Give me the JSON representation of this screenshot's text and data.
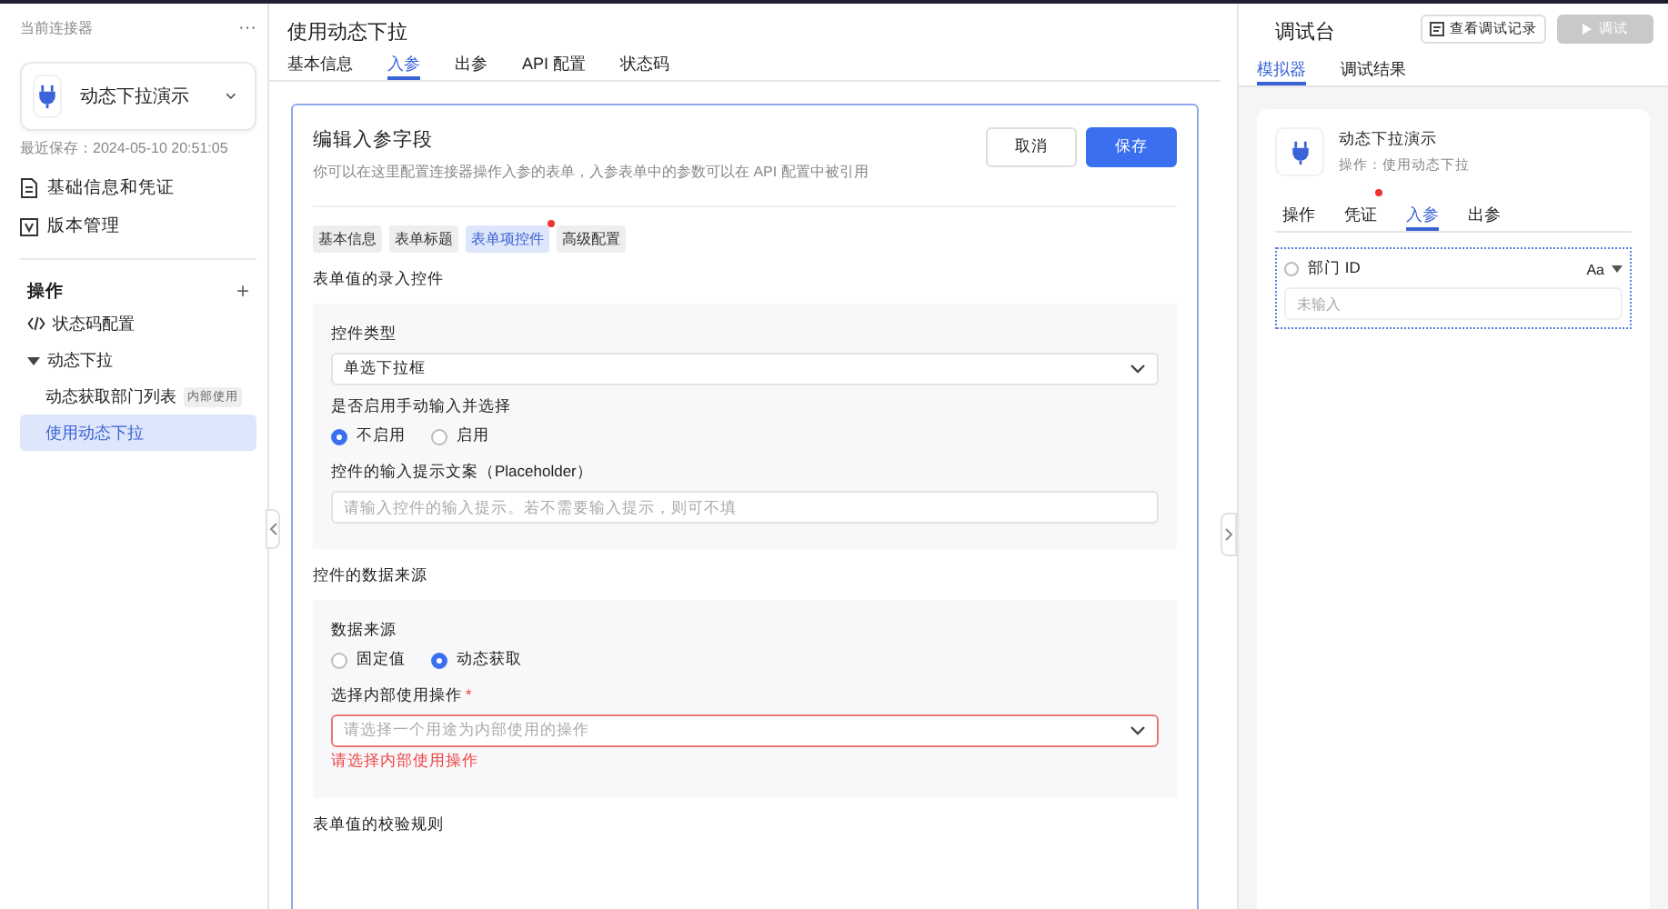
{
  "sidebar": {
    "header": "当前连接器",
    "more": "···",
    "connector": {
      "name": "动态下拉演示"
    },
    "last_saved": "最近保存：2024-05-10 20:51:05",
    "links": [
      {
        "label": "基础信息和凭证",
        "kind": "doc"
      },
      {
        "label": "版本管理",
        "kind": "version"
      }
    ],
    "operations_title": "操作",
    "add": "+",
    "tree": [
      {
        "label": "状态码配置",
        "kind": "code",
        "selected": false
      },
      {
        "label": "动态下拉",
        "kind": "folder",
        "selected": false,
        "expanded": true,
        "children": [
          {
            "label": "动态获取部门列表",
            "badge": "内部使用",
            "selected": false
          },
          {
            "label": "使用动态下拉",
            "selected": true
          }
        ]
      }
    ]
  },
  "main": {
    "title": "使用动态下拉",
    "tabs": [
      {
        "label": "基本信息",
        "selected": false
      },
      {
        "label": "入参",
        "selected": true
      },
      {
        "label": "出参",
        "selected": false
      },
      {
        "label": "API 配置",
        "selected": false
      },
      {
        "label": "状态码",
        "selected": false
      }
    ],
    "editor": {
      "title": "编辑入参字段",
      "description": "你可以在这里配置连接器操作入参的表单，入参表单中的参数可以在 API 配置中被引用",
      "cancel": "取消",
      "save": "保存",
      "subtabs": [
        {
          "label": "基本信息",
          "selected": false,
          "dot": false
        },
        {
          "label": "表单标题",
          "selected": false,
          "dot": false
        },
        {
          "label": "表单项控件",
          "selected": true,
          "dot": true
        },
        {
          "label": "高级配置",
          "selected": false,
          "dot": false
        }
      ],
      "sections": [
        {
          "title": "表单值的录入控件",
          "fields": [
            {
              "kind": "select",
              "label": "控件类型",
              "value": "单选下拉框"
            },
            {
              "kind": "radio",
              "label": "是否启用手动输入并选择",
              "options": [
                {
                  "label": "不启用",
                  "selected": true
                },
                {
                  "label": "启用",
                  "selected": false
                }
              ]
            },
            {
              "kind": "text",
              "label": "控件的输入提示文案（Placeholder）",
              "placeholder": "请输入控件的输入提示。若不需要输入提示，则可不填"
            }
          ]
        },
        {
          "title": "控件的数据来源",
          "fields": [
            {
              "kind": "radio",
              "label": "数据来源",
              "options": [
                {
                  "label": "固定值",
                  "selected": false
                },
                {
                  "label": "动态获取",
                  "selected": true
                }
              ]
            },
            {
              "kind": "select",
              "label": "选择内部使用操作",
              "required_mark": "*",
              "placeholder": "请选择一个用途为内部使用的操作",
              "error": "请选择内部使用操作"
            }
          ]
        },
        {
          "title": "表单值的校验规则"
        }
      ]
    }
  },
  "debug": {
    "title": "调试台",
    "history": "查看调试记录",
    "run": {
      "label": "调试",
      "disabled": true
    },
    "tabs": [
      {
        "label": "模拟器",
        "selected": true
      },
      {
        "label": "调试结果",
        "selected": false
      }
    ],
    "card": {
      "name": "动态下拉演示",
      "subtitle": "操作：使用动态下拉",
      "tabs": [
        {
          "label": "操作",
          "selected": false,
          "dot": false
        },
        {
          "label": "凭证",
          "selected": false,
          "dot": true
        },
        {
          "label": "入参",
          "selected": true,
          "dot": false
        },
        {
          "label": "出参",
          "selected": false,
          "dot": false
        }
      ],
      "param": {
        "selected": false,
        "label": "部门 ID",
        "type_glyph": "Aa",
        "placeholder": "未输入"
      }
    }
  }
}
